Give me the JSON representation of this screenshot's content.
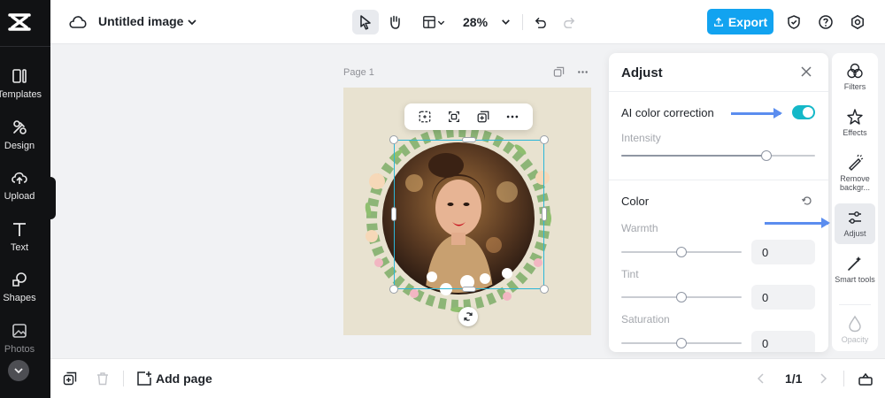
{
  "app": {
    "document_title": "Untitled image",
    "zoom": "28%",
    "export_label": "Export"
  },
  "left_nav": [
    {
      "label": "Templates",
      "icon": "templates-icon"
    },
    {
      "label": "Design",
      "icon": "design-icon"
    },
    {
      "label": "Upload",
      "icon": "upload-icon"
    },
    {
      "label": "Text",
      "icon": "text-icon"
    },
    {
      "label": "Shapes",
      "icon": "shapes-icon"
    },
    {
      "label": "Photos",
      "icon": "photos-icon"
    }
  ],
  "canvas": {
    "page_label": "Page 1"
  },
  "adjust_panel": {
    "title": "Adjust",
    "ai_color_correction_label": "AI color correction",
    "ai_color_correction_on": true,
    "intensity_label": "Intensity",
    "intensity_level": 0.75,
    "color_section_label": "Color",
    "warmth_label": "Warmth",
    "warmth_value": "0",
    "tint_label": "Tint",
    "tint_value": "0",
    "saturation_label": "Saturation",
    "saturation_value": "0"
  },
  "right_panel": [
    {
      "label": "Filters",
      "icon": "filters-icon"
    },
    {
      "label": "Effects",
      "icon": "effects-icon"
    },
    {
      "label": "Remove backgr...",
      "icon": "remove-background-icon"
    },
    {
      "label": "Adjust",
      "icon": "adjust-icon"
    },
    {
      "label": "Smart tools",
      "icon": "smart-tools-icon"
    },
    {
      "label": "Opacity",
      "icon": "opacity-icon"
    }
  ],
  "bottom_bar": {
    "add_page_label": "Add page",
    "page_count": "1/1"
  },
  "colors": {
    "accent": "#12a3f0",
    "toggle_on": "#14b8c8",
    "selection": "#2bb6d8",
    "annotation_arrow": "#5b8def"
  }
}
